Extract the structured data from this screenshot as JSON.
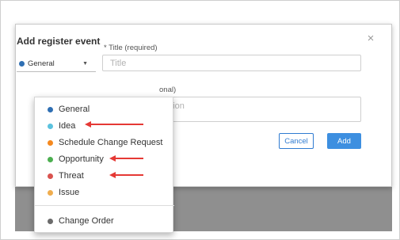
{
  "modal": {
    "title": "Add register event",
    "close_label": "×",
    "title_field": {
      "label": "* Title (required)",
      "placeholder": "Title"
    },
    "description_field": {
      "label_visible": "onal)",
      "placeholder_visible": "ption"
    },
    "type_select": {
      "selected": "General",
      "selected_color": "#2f6fb3",
      "caret": "▼"
    },
    "cancel_label": "Cancel",
    "add_label": "Add"
  },
  "dropdown": {
    "items": [
      {
        "label": "General",
        "color": "#2f6fb3"
      },
      {
        "label": "Idea",
        "color": "#5bc2de"
      },
      {
        "label": "Schedule Change Request",
        "color": "#f5891f"
      },
      {
        "label": "Opportunity",
        "color": "#4caf50"
      },
      {
        "label": "Threat",
        "color": "#d9534f"
      },
      {
        "label": "Issue",
        "color": "#f0ad4e"
      },
      {
        "label": "Change Order",
        "color": "#6b6b6b"
      }
    ]
  },
  "annotation_color": "#e53935"
}
